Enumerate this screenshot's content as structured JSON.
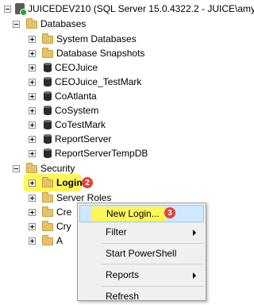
{
  "tree": {
    "server": "JUICEDEV210 (SQL Server 15.0.4322.2 - JUICE\\amy)",
    "databases_label": "Databases",
    "database_items": [
      "System Databases",
      "Database Snapshots",
      "CEOJuice",
      "CEOJuice_TestMark",
      "CoAtlanta",
      "CoSystem",
      "CoTestMark",
      "ReportServer",
      "ReportServerTempDB"
    ],
    "security_label": "Security",
    "security_items": [
      "Logins",
      "Server Roles",
      "Cre",
      "Cry",
      "A"
    ]
  },
  "context_menu": {
    "new_login": "New Login...",
    "filter": "Filter",
    "start_powershell": "Start PowerShell",
    "reports": "Reports",
    "refresh": "Refresh"
  },
  "badges": {
    "logins_step": "2",
    "new_login_step": "3"
  },
  "colors": {
    "highlight": "#fff65a",
    "badge": "#e0443a",
    "menu_hover": "#cde8ff"
  }
}
